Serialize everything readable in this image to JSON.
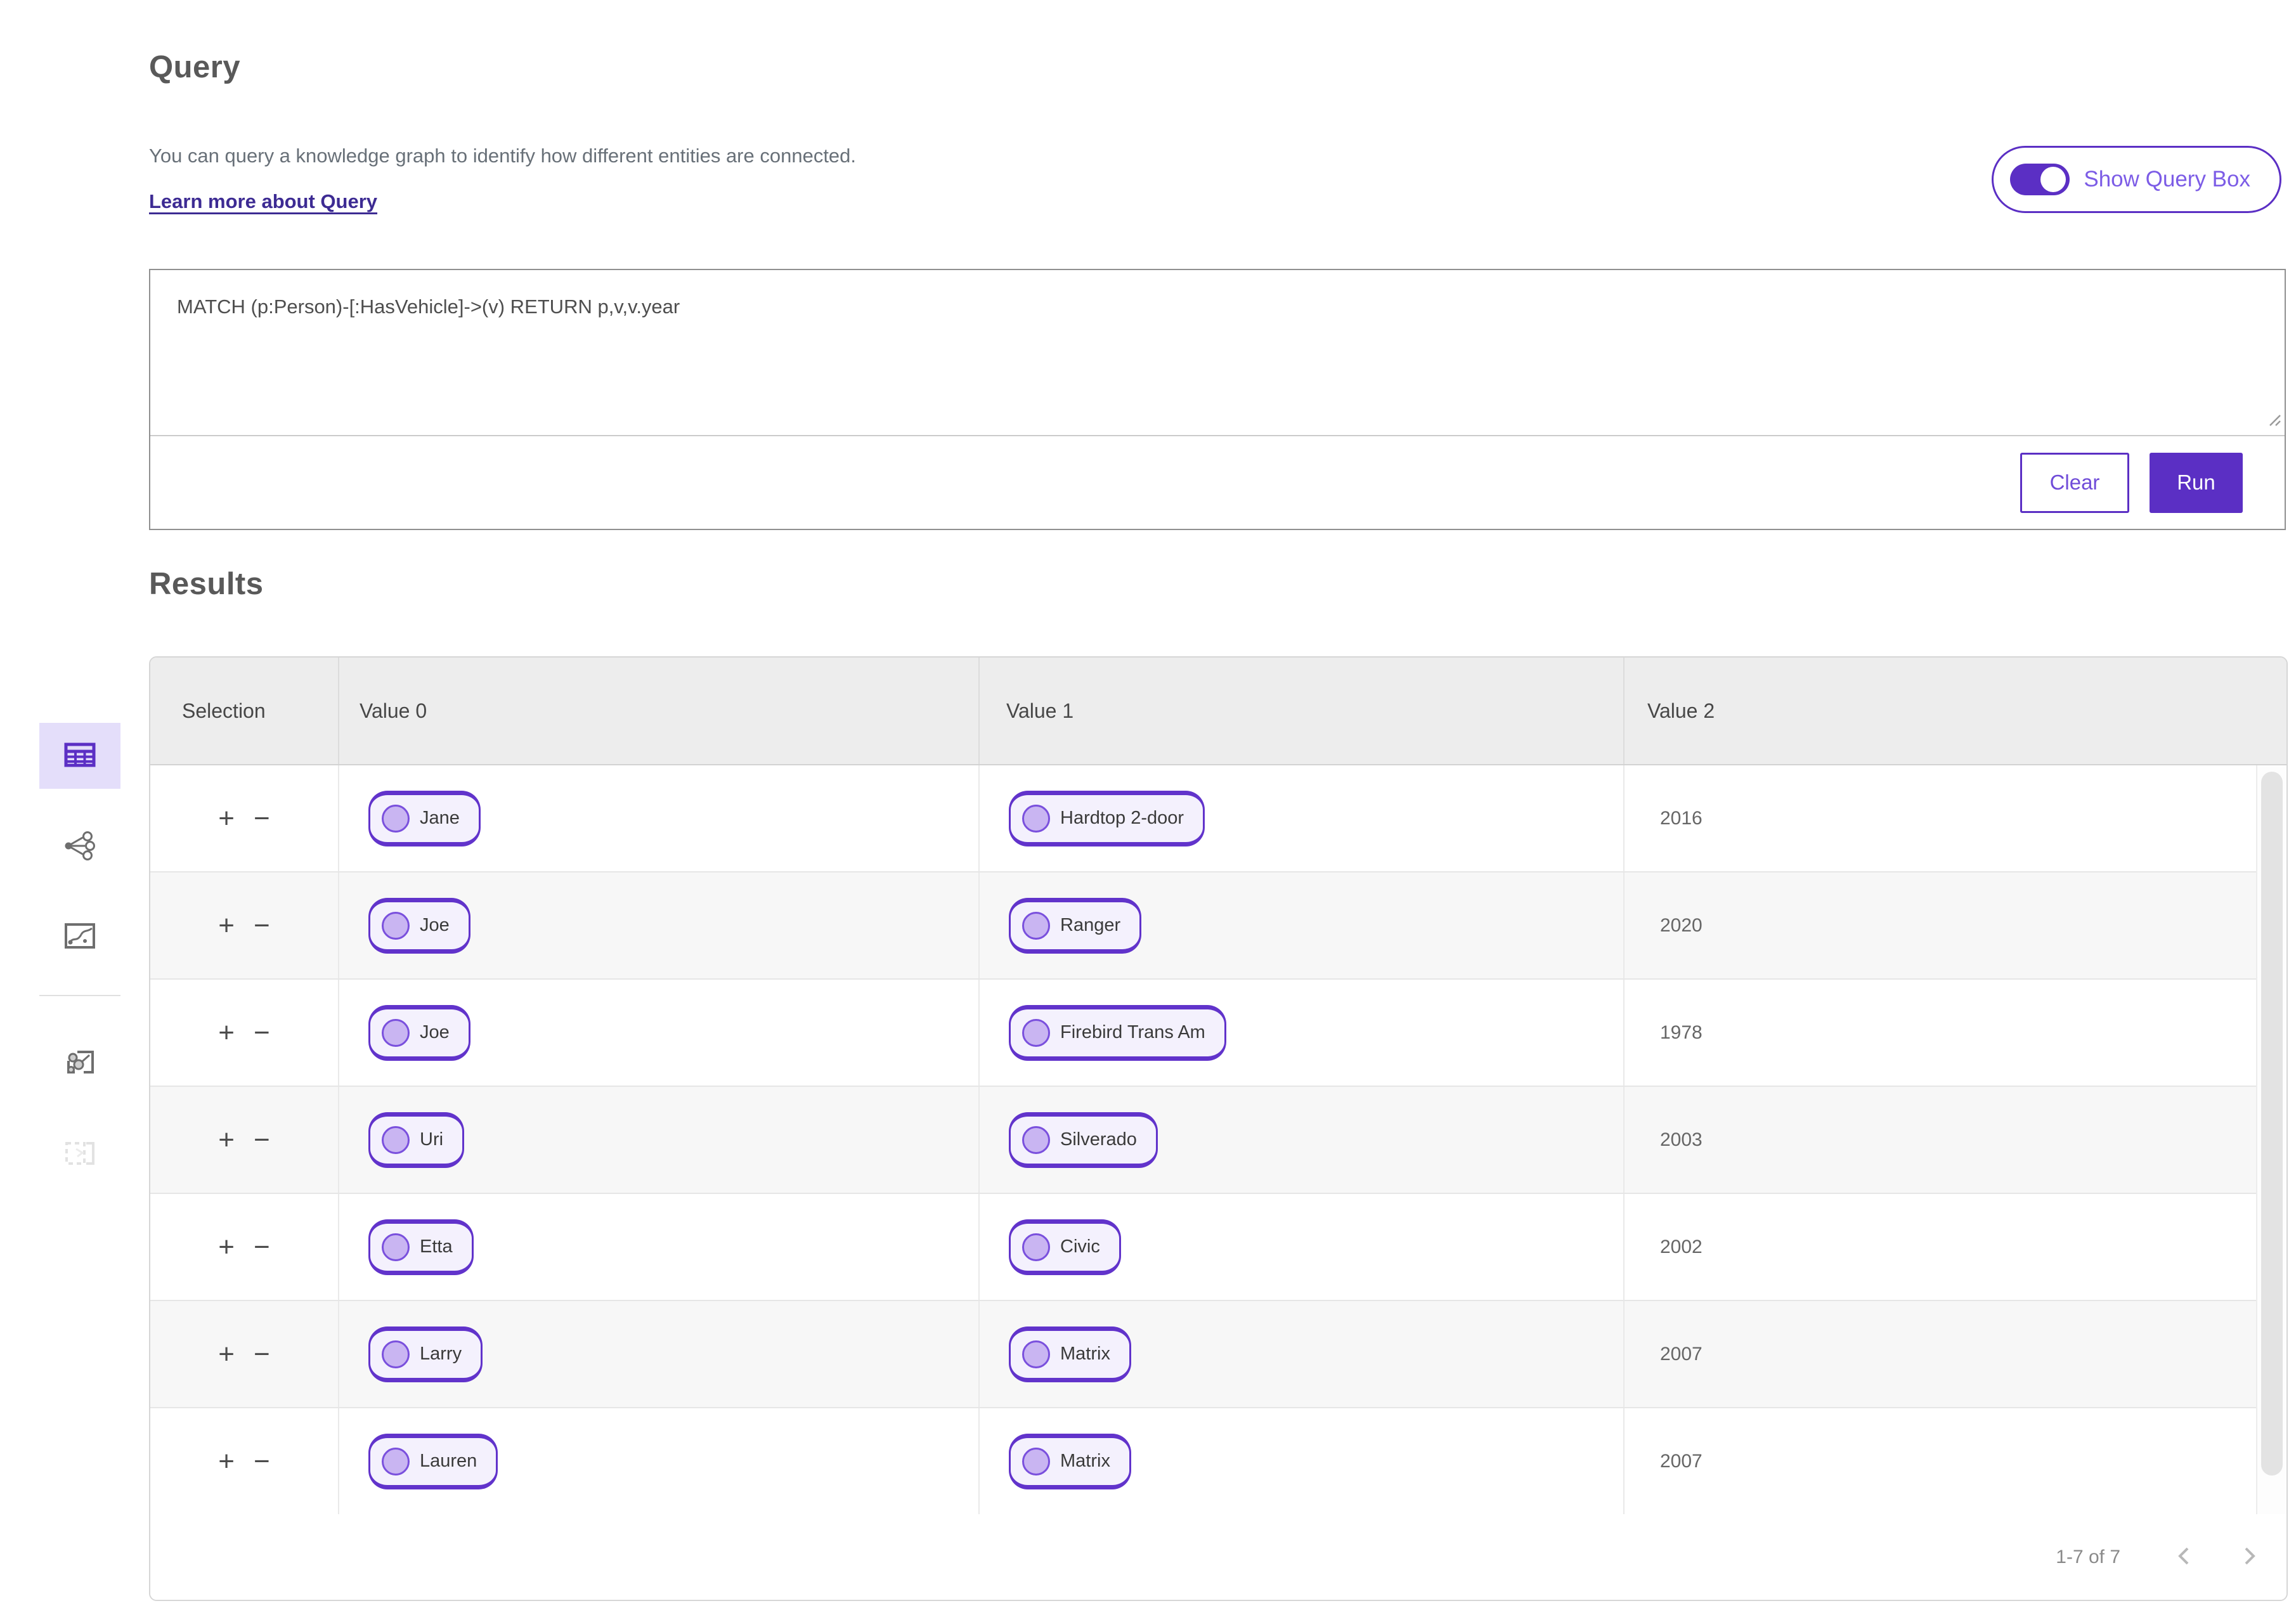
{
  "page": {
    "title": "Query",
    "description": "You can query a knowledge graph to identify how different entities are connected.",
    "learn_more": "Learn more about Query",
    "toggle_label": "Show Query Box",
    "query_text": "MATCH (p:Person)-[:HasVehicle]->(v) RETURN p,v,v.year",
    "clear_label": "Clear",
    "run_label": "Run",
    "results_title": "Results"
  },
  "table": {
    "columns": [
      "Selection",
      "Value 0",
      "Value 1",
      "Value 2"
    ],
    "row_actions": {
      "expand": "+",
      "collapse": "−"
    },
    "rows": [
      {
        "value0": "Jane",
        "value1": "Hardtop 2-door",
        "value2": "2016"
      },
      {
        "value0": "Joe",
        "value1": "Ranger",
        "value2": "2020"
      },
      {
        "value0": "Joe",
        "value1": "Firebird Trans Am",
        "value2": "1978"
      },
      {
        "value0": "Uri",
        "value1": "Silverado",
        "value2": "2003"
      },
      {
        "value0": "Etta",
        "value1": "Civic",
        "value2": "2002"
      },
      {
        "value0": "Larry",
        "value1": "Matrix",
        "value2": "2007"
      },
      {
        "value0": "Lauren",
        "value1": "Matrix",
        "value2": "2007"
      }
    ],
    "pagination": {
      "label": "1-7 of 7"
    }
  },
  "sidebar": {
    "items": [
      {
        "icon": "table-view-icon",
        "selected": true
      },
      {
        "icon": "graph-view-icon",
        "selected": false
      },
      {
        "icon": "map-view-icon",
        "selected": false
      },
      {
        "icon": "graph-map-view-icon",
        "selected": false
      },
      {
        "icon": "region-select-icon",
        "selected": false,
        "disabled": true
      }
    ]
  },
  "icons": {
    "toggle": "switch-on-icon",
    "resize": "resize-handle-icon",
    "pagination": [
      "chevron-left-icon",
      "chevron-right-icon"
    ]
  },
  "colors": {
    "accent": "#5b2fc4",
    "accent_light_bg": "#e4defa",
    "pill_bg": "#f4f1fd",
    "pill_border": "#6133cb",
    "link": "#3d2b93",
    "header_bg": "#ededed",
    "row_alt_bg": "#f7f7f7",
    "border": "#d6d6d6"
  }
}
